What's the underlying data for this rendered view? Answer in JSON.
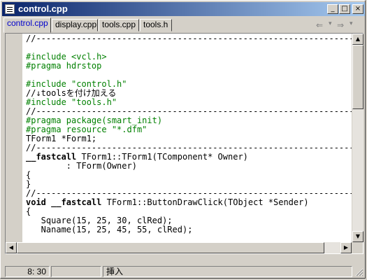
{
  "window": {
    "title": "control.cpp"
  },
  "title_buttons": {
    "minimize": "_",
    "maximize": "□",
    "close": "×"
  },
  "tabs": [
    "control.cpp",
    "display.cpp",
    "tools.cpp",
    "tools.h"
  ],
  "nav": {
    "back": "⇐",
    "forward": "⇒",
    "dropdown": "▾"
  },
  "code_lines": [
    "//---------------------------------------------------------------------------",
    "",
    "#include <vcl.h>",
    "#pragma hdrstop",
    "",
    "#include \"control.h\"",
    "//↓toolsを付け加える",
    "#include \"tools.h\"",
    "//---------------------------------------------------------------------------",
    "#pragma package(smart_init)",
    "#pragma resource \"*.dfm\"",
    "TForm1 *Form1;",
    "//---------------------------------------------------------------------------",
    "__fastcall TForm1::TForm1(TComponent* Owner)",
    "        : TForm(Owner)",
    "{",
    "}",
    "//---------------------------------------------------------------------------",
    "void __fastcall TForm1::ButtonDrawClick(TObject *Sender)",
    "{",
    "   Square(15, 25, 30, clRed);",
    "   Naname(15, 25, 45, 55, clRed);",
    "",
    "}"
  ],
  "status": {
    "position": "8: 30",
    "modified": "",
    "mode": "挿入"
  }
}
